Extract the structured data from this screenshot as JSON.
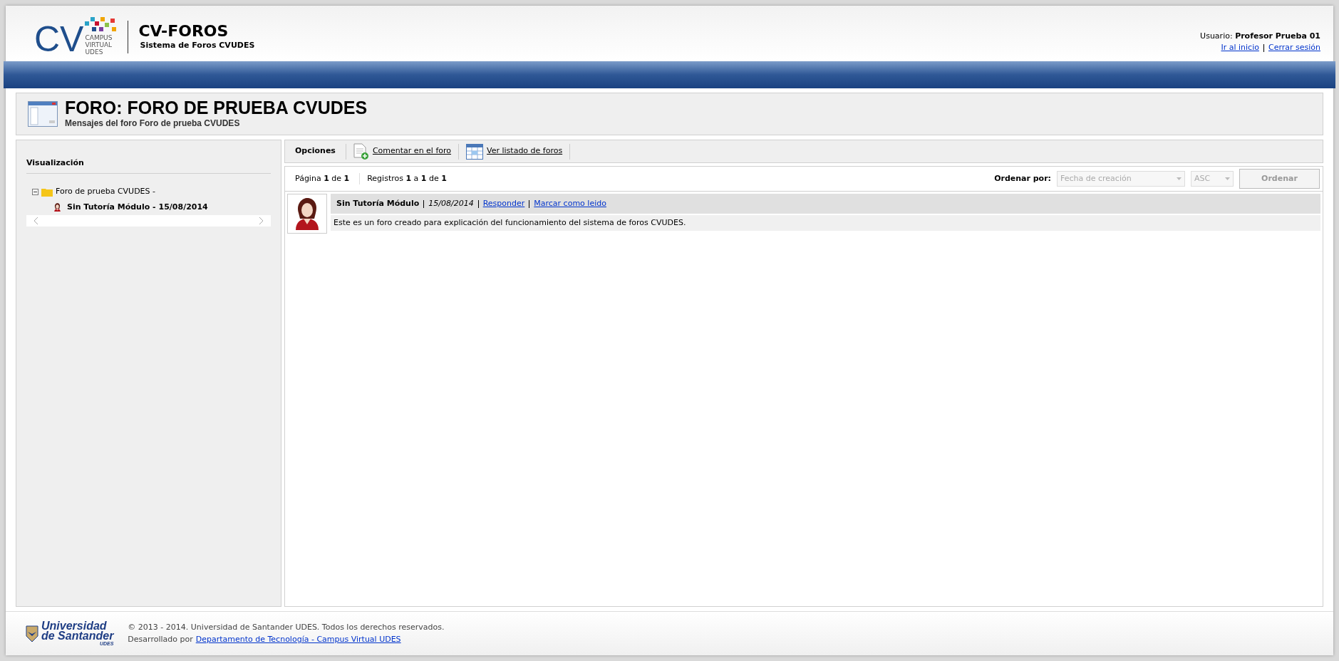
{
  "header": {
    "logo": {
      "mark": "CV",
      "lines": [
        "CAMPUS",
        "VIRTUAL",
        "UDES"
      ]
    },
    "app_title": "CV-FOROS",
    "app_subtitle": "Sistema de Foros CVUDES",
    "user_label": "Usuario:",
    "user_name": "Profesor Prueba 01",
    "links": [
      "Ir al inicio",
      "Cerrar sesión"
    ]
  },
  "page_title": {
    "title": "FORO: FORO DE PRUEBA CVUDES",
    "subtitle": "Mensajes del foro Foro de prueba CVUDES"
  },
  "sidebar": {
    "title": "Visualización",
    "tree": [
      {
        "label": "Foro de prueba CVUDES -",
        "expanded": true,
        "children": [
          {
            "label": "Sin Tutoría Módulo - 15/08/2014"
          }
        ]
      }
    ]
  },
  "toolbar": {
    "label": "Opciones",
    "actions": [
      "Comentar en el foro",
      "Ver listado de foros"
    ]
  },
  "pager": {
    "page": "Página **1** de **1**",
    "records": "Registros **1** a **1** de **1**",
    "sort_label": "Ordenar por:",
    "sort_field": {
      "value": "Fecha de creación",
      "disabled": true
    },
    "sort_order": {
      "value": "ASC",
      "disabled": true
    },
    "sort_button": {
      "label": "Ordenar",
      "disabled": true
    }
  },
  "messages": [
    {
      "author": "Sin Tutoría Módulo",
      "date": "15/08/2014",
      "links": [
        "Responder",
        "Marcar como leido"
      ],
      "body": "Este es un foro creado para explicación del funcionamiento del sistema de foros CVUDES."
    }
  ],
  "footer": {
    "logo_lines": [
      "Universidad",
      "de Santander",
      "UDES"
    ],
    "copyright": "© 2013 - 2014. Universidad de Santander UDES. Todos los derechos reservados.",
    "developed_by": "Desarrollado por",
    "developer_link": "Departamento de Tecnología - Campus Virtual UDES"
  }
}
